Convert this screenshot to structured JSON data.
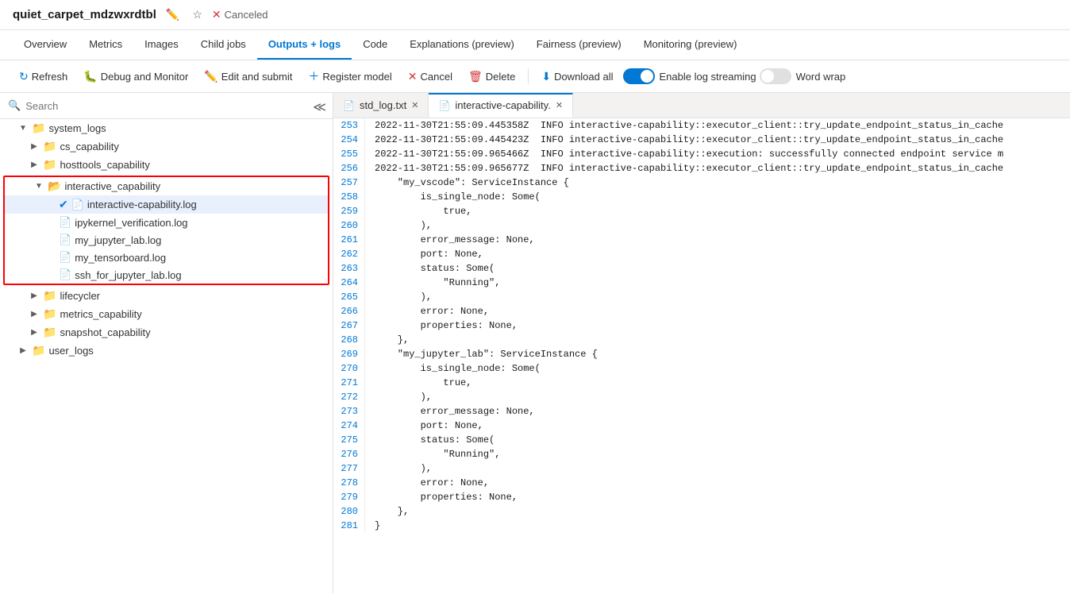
{
  "header": {
    "title": "quiet_carpet_mdzwxrdtbl",
    "status": "Canceled"
  },
  "nav": {
    "tabs": [
      {
        "label": "Overview",
        "active": false
      },
      {
        "label": "Metrics",
        "active": false
      },
      {
        "label": "Images",
        "active": false
      },
      {
        "label": "Child jobs",
        "active": false
      },
      {
        "label": "Outputs + logs",
        "active": true
      },
      {
        "label": "Code",
        "active": false
      },
      {
        "label": "Explanations (preview)",
        "active": false
      },
      {
        "label": "Fairness (preview)",
        "active": false
      },
      {
        "label": "Monitoring (preview)",
        "active": false
      }
    ]
  },
  "toolbar": {
    "refresh": "Refresh",
    "debug_monitor": "Debug and Monitor",
    "edit_submit": "Edit and submit",
    "register_model": "Register model",
    "cancel": "Cancel",
    "delete": "Delete",
    "download_all": "Download all",
    "enable_log_streaming": "Enable log streaming",
    "word_wrap": "Word wrap"
  },
  "sidebar": {
    "search_placeholder": "Search",
    "tree": [
      {
        "id": "system_logs",
        "label": "system_logs",
        "type": "folder",
        "level": 0,
        "expanded": true
      },
      {
        "id": "cs_capability",
        "label": "cs_capability",
        "type": "folder",
        "level": 1,
        "expanded": false
      },
      {
        "id": "hosttools_capability",
        "label": "hosttools_capability",
        "type": "folder",
        "level": 1,
        "expanded": false
      },
      {
        "id": "interactive_capability",
        "label": "interactive_capability",
        "type": "folder",
        "level": 1,
        "expanded": true,
        "highlighted": true
      },
      {
        "id": "interactive-capability.log",
        "label": "interactive-capability.log",
        "type": "file",
        "level": 2,
        "selected": true
      },
      {
        "id": "ipykernel_verification.log",
        "label": "ipykernel_verification.log",
        "type": "file",
        "level": 2
      },
      {
        "id": "my_jupyter_lab.log",
        "label": "my_jupyter_lab.log",
        "type": "file",
        "level": 2
      },
      {
        "id": "my_tensorboard.log",
        "label": "my_tensorboard.log",
        "type": "file",
        "level": 2
      },
      {
        "id": "ssh_for_jupyter_lab.log",
        "label": "ssh_for_jupyter_lab.log",
        "type": "file",
        "level": 2
      },
      {
        "id": "lifecycler",
        "label": "lifecycler",
        "type": "folder",
        "level": 1,
        "expanded": false
      },
      {
        "id": "metrics_capability",
        "label": "metrics_capability",
        "type": "folder",
        "level": 1,
        "expanded": false
      },
      {
        "id": "snapshot_capability",
        "label": "snapshot_capability",
        "type": "folder",
        "level": 1,
        "expanded": false
      },
      {
        "id": "user_logs",
        "label": "user_logs",
        "type": "folder",
        "level": 0,
        "expanded": false
      }
    ]
  },
  "file_tabs": [
    {
      "label": "std_log.txt",
      "active": false
    },
    {
      "label": "interactive-capability.",
      "active": true
    }
  ],
  "code": {
    "lines": [
      {
        "num": 253,
        "content": "2022-11-30T21:55:09.445358Z  INFO interactive-capability::executor_client::try_update_endpoint_status_in_cache"
      },
      {
        "num": 254,
        "content": "2022-11-30T21:55:09.445423Z  INFO interactive-capability::executor_client::try_update_endpoint_status_in_cache"
      },
      {
        "num": 255,
        "content": "2022-11-30T21:55:09.965466Z  INFO interactive-capability::execution: successfully connected endpoint service m"
      },
      {
        "num": 256,
        "content": "2022-11-30T21:55:09.965677Z  INFO interactive-capability::executor_client::try_update_endpoint_status_in_cache"
      },
      {
        "num": 257,
        "content": "    \"my_vscode\": ServiceInstance {"
      },
      {
        "num": 258,
        "content": "        is_single_node: Some("
      },
      {
        "num": 259,
        "content": "            true,"
      },
      {
        "num": 260,
        "content": "        ),"
      },
      {
        "num": 261,
        "content": "        error_message: None,"
      },
      {
        "num": 262,
        "content": "        port: None,"
      },
      {
        "num": 263,
        "content": "        status: Some("
      },
      {
        "num": 264,
        "content": "            \"Running\","
      },
      {
        "num": 265,
        "content": "        ),"
      },
      {
        "num": 266,
        "content": "        error: None,"
      },
      {
        "num": 267,
        "content": "        properties: None,"
      },
      {
        "num": 268,
        "content": "    },"
      },
      {
        "num": 269,
        "content": "    \"my_jupyter_lab\": ServiceInstance {"
      },
      {
        "num": 270,
        "content": "        is_single_node: Some("
      },
      {
        "num": 271,
        "content": "            true,"
      },
      {
        "num": 272,
        "content": "        ),"
      },
      {
        "num": 273,
        "content": "        error_message: None,"
      },
      {
        "num": 274,
        "content": "        port: None,"
      },
      {
        "num": 275,
        "content": "        status: Some("
      },
      {
        "num": 276,
        "content": "            \"Running\","
      },
      {
        "num": 277,
        "content": "        ),"
      },
      {
        "num": 278,
        "content": "        error: None,"
      },
      {
        "num": 279,
        "content": "        properties: None,"
      },
      {
        "num": 280,
        "content": "    },"
      },
      {
        "num": 281,
        "content": "}"
      }
    ]
  }
}
